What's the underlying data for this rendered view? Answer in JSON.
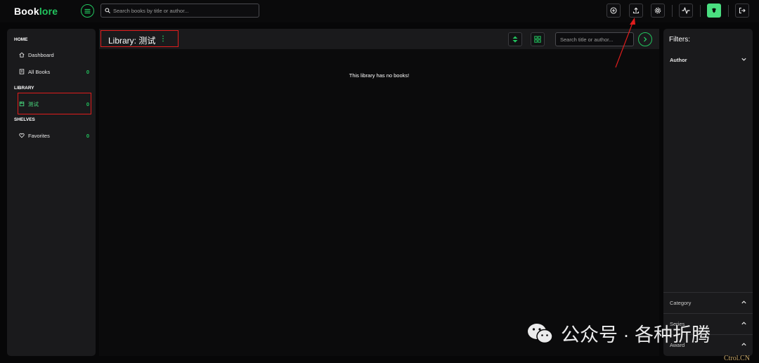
{
  "app": {
    "logo_part1": "Book",
    "logo_part2": "lore",
    "search_placeholder": "Search books by title or author..."
  },
  "sidebar": {
    "home_title": "HOME",
    "dashboard_label": "Dashboard",
    "all_books_label": "All Books",
    "all_books_count": "0",
    "library_title": "LIBRARY",
    "library_item_label": "测试",
    "library_item_count": "0",
    "shelves_title": "SHELVES",
    "favorites_label": "Favorites",
    "favorites_count": "0"
  },
  "main": {
    "title": "Library: 测试",
    "search_placeholder": "Search title or author...",
    "empty_message": "This library has no books!"
  },
  "filters": {
    "title": "Filters:",
    "author_label": "Author",
    "category_label": "Category",
    "series_label": "Series",
    "award_label": "Award"
  },
  "watermark": {
    "text": "公众号 · 各种折腾",
    "tag": "Ctrol.CN"
  },
  "colors": {
    "accent": "#22c55e",
    "annotation": "#e11d1d",
    "background": "#070708",
    "panel": "#1a1a1c"
  },
  "icons": [
    "menu-icon",
    "search-icon",
    "plus-circle-icon",
    "upload-icon",
    "gear-icon",
    "activity-icon",
    "user-avatar-icon",
    "logout-icon",
    "home-icon",
    "book-icon",
    "library-icon",
    "heart-icon",
    "kebab-icon",
    "sort-icon",
    "grid-icon",
    "arrow-right-icon",
    "chevron-down-icon",
    "chevron-up-icon",
    "wechat-icon"
  ]
}
